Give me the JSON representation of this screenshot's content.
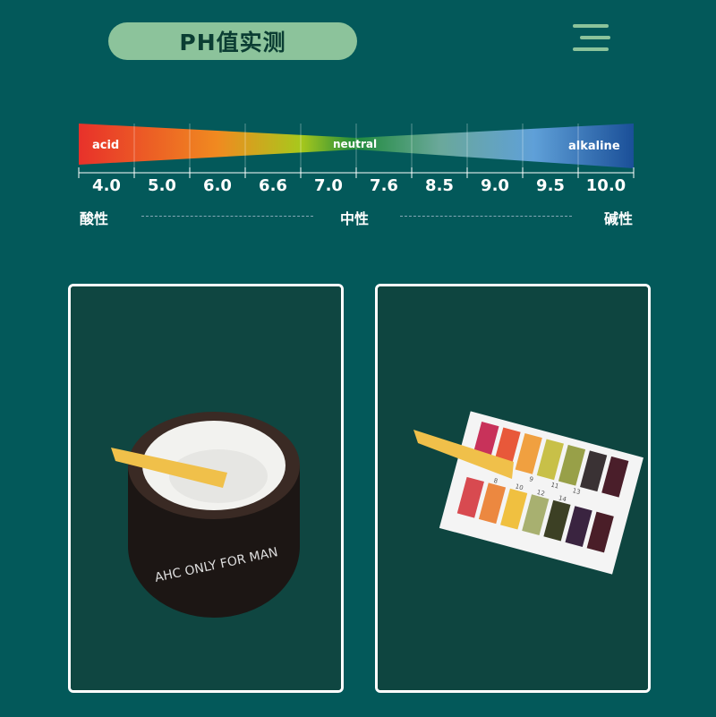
{
  "header": {
    "title": "PH值实测",
    "menu_icon": "hamburger-menu-icon"
  },
  "ph_scale": {
    "labels": {
      "acid": "acid",
      "neutral": "neutral",
      "alkaline": "alkaline"
    },
    "ticks": [
      "4.0",
      "5.0",
      "6.0",
      "6.6",
      "7.0",
      "7.6",
      "8.5",
      "9.0",
      "9.5",
      "10.0"
    ],
    "categories": {
      "acid": "酸性",
      "neutral": "中性",
      "alkaline": "碱性"
    },
    "gradient_colors": [
      "#e8312a",
      "#f08a20",
      "#a8c81c",
      "#1f8a3c",
      "#6aa89a",
      "#5fa0d8",
      "#1a5aa8"
    ]
  },
  "photos": [
    {
      "subject": "cream jar with pH test strip",
      "jar_text": "AHC ONLY FOR MAN"
    },
    {
      "subject": "pH test strip with color chart",
      "chart_numbers": [
        "7",
        "9",
        "11",
        "13",
        "8",
        "10",
        "12",
        "14"
      ]
    }
  ],
  "colors": {
    "background": "#03595a",
    "pill": "#8cc39b",
    "photo_bg": "#0e4540"
  }
}
